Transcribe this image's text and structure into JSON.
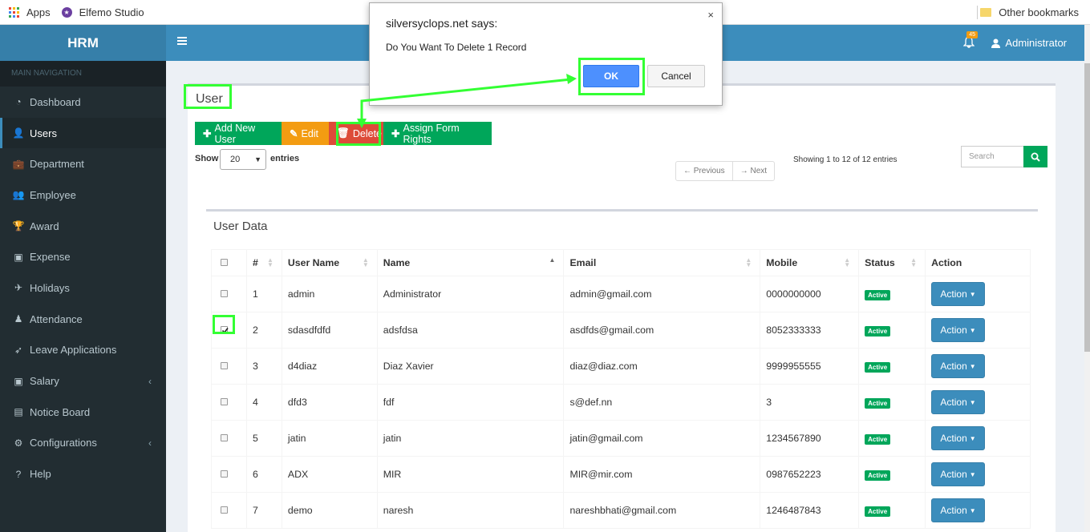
{
  "bookmarks": {
    "apps": "Apps",
    "elfemo": "Elfemo Studio",
    "other": "Other bookmarks"
  },
  "sidebar": {
    "logo": "HRM",
    "header": "MAIN NAVIGATION",
    "items": [
      {
        "label": "Dashboard",
        "icon": "dashboard-icon"
      },
      {
        "label": "Users",
        "icon": "user-icon",
        "active": true
      },
      {
        "label": "Department",
        "icon": "briefcase-icon"
      },
      {
        "label": "Employee",
        "icon": "users-icon"
      },
      {
        "label": "Award",
        "icon": "trophy-icon"
      },
      {
        "label": "Expense",
        "icon": "money-icon"
      },
      {
        "label": "Holidays",
        "icon": "plane-icon"
      },
      {
        "label": "Attendance",
        "icon": "person-icon"
      },
      {
        "label": "Leave Applications",
        "icon": "rocket-icon"
      },
      {
        "label": "Salary",
        "icon": "money-icon",
        "caret": true
      },
      {
        "label": "Notice Board",
        "icon": "file-icon"
      },
      {
        "label": "Configurations",
        "icon": "gears-icon",
        "caret": true
      },
      {
        "label": "Help",
        "icon": "question-icon"
      }
    ]
  },
  "header": {
    "notifications": "45",
    "user": "Administrator"
  },
  "page": {
    "title": "User",
    "buttons": {
      "add": "Add New User",
      "edit": "Edit",
      "delete": "Delete",
      "rights": "Assign Form Rights"
    },
    "show": "Show",
    "page_size": "20",
    "entries": "entries",
    "previous": "← Previous",
    "next": "→ Next",
    "showing": "Showing 1 to 12 of 12 entries",
    "search_placeholder": "Search"
  },
  "table": {
    "title": "User Data",
    "columns": [
      "#",
      "User Name",
      "Name",
      "Email",
      "Mobile",
      "Status",
      "Action"
    ],
    "rows": [
      {
        "num": "1",
        "username": "admin",
        "name": "Administrator",
        "email": "admin@gmail.com",
        "mobile": "0000000000",
        "status": "Active",
        "action": "Action",
        "checked": false
      },
      {
        "num": "2",
        "username": "sdasdfdfd",
        "name": "adsfdsa",
        "email": "asdfds@gmail.com",
        "mobile": "8052333333",
        "status": "Active",
        "action": "Action",
        "checked": true
      },
      {
        "num": "3",
        "username": "d4diaz",
        "name": "Diaz Xavier",
        "email": "diaz@diaz.com",
        "mobile": "9999955555",
        "status": "Active",
        "action": "Action",
        "checked": false
      },
      {
        "num": "4",
        "username": "dfd3",
        "name": "fdf",
        "email": "s@def.nn",
        "mobile": "3",
        "status": "Active",
        "action": "Action",
        "checked": false
      },
      {
        "num": "5",
        "username": "jatin",
        "name": "jatin",
        "email": "jatin@gmail.com",
        "mobile": "1234567890",
        "status": "Active",
        "action": "Action",
        "checked": false
      },
      {
        "num": "6",
        "username": "ADX",
        "name": "MIR",
        "email": "MIR@mir.com",
        "mobile": "0987652223",
        "status": "Active",
        "action": "Action",
        "checked": false
      },
      {
        "num": "7",
        "username": "demo",
        "name": "naresh",
        "email": "nareshbhati@gmail.com",
        "mobile": "1246487843",
        "status": "Active",
        "action": "Action",
        "checked": false
      }
    ]
  },
  "dialog": {
    "title": "silversyclops.net says:",
    "close": "×",
    "message": "Do You Want To Delete 1 Record",
    "ok": "OK",
    "cancel": "Cancel"
  },
  "colors": {
    "highlight": "#33ff33",
    "primary": "#3c8dbc",
    "success": "#00a65a",
    "danger": "#dd4b39",
    "warning": "#f39c12"
  }
}
